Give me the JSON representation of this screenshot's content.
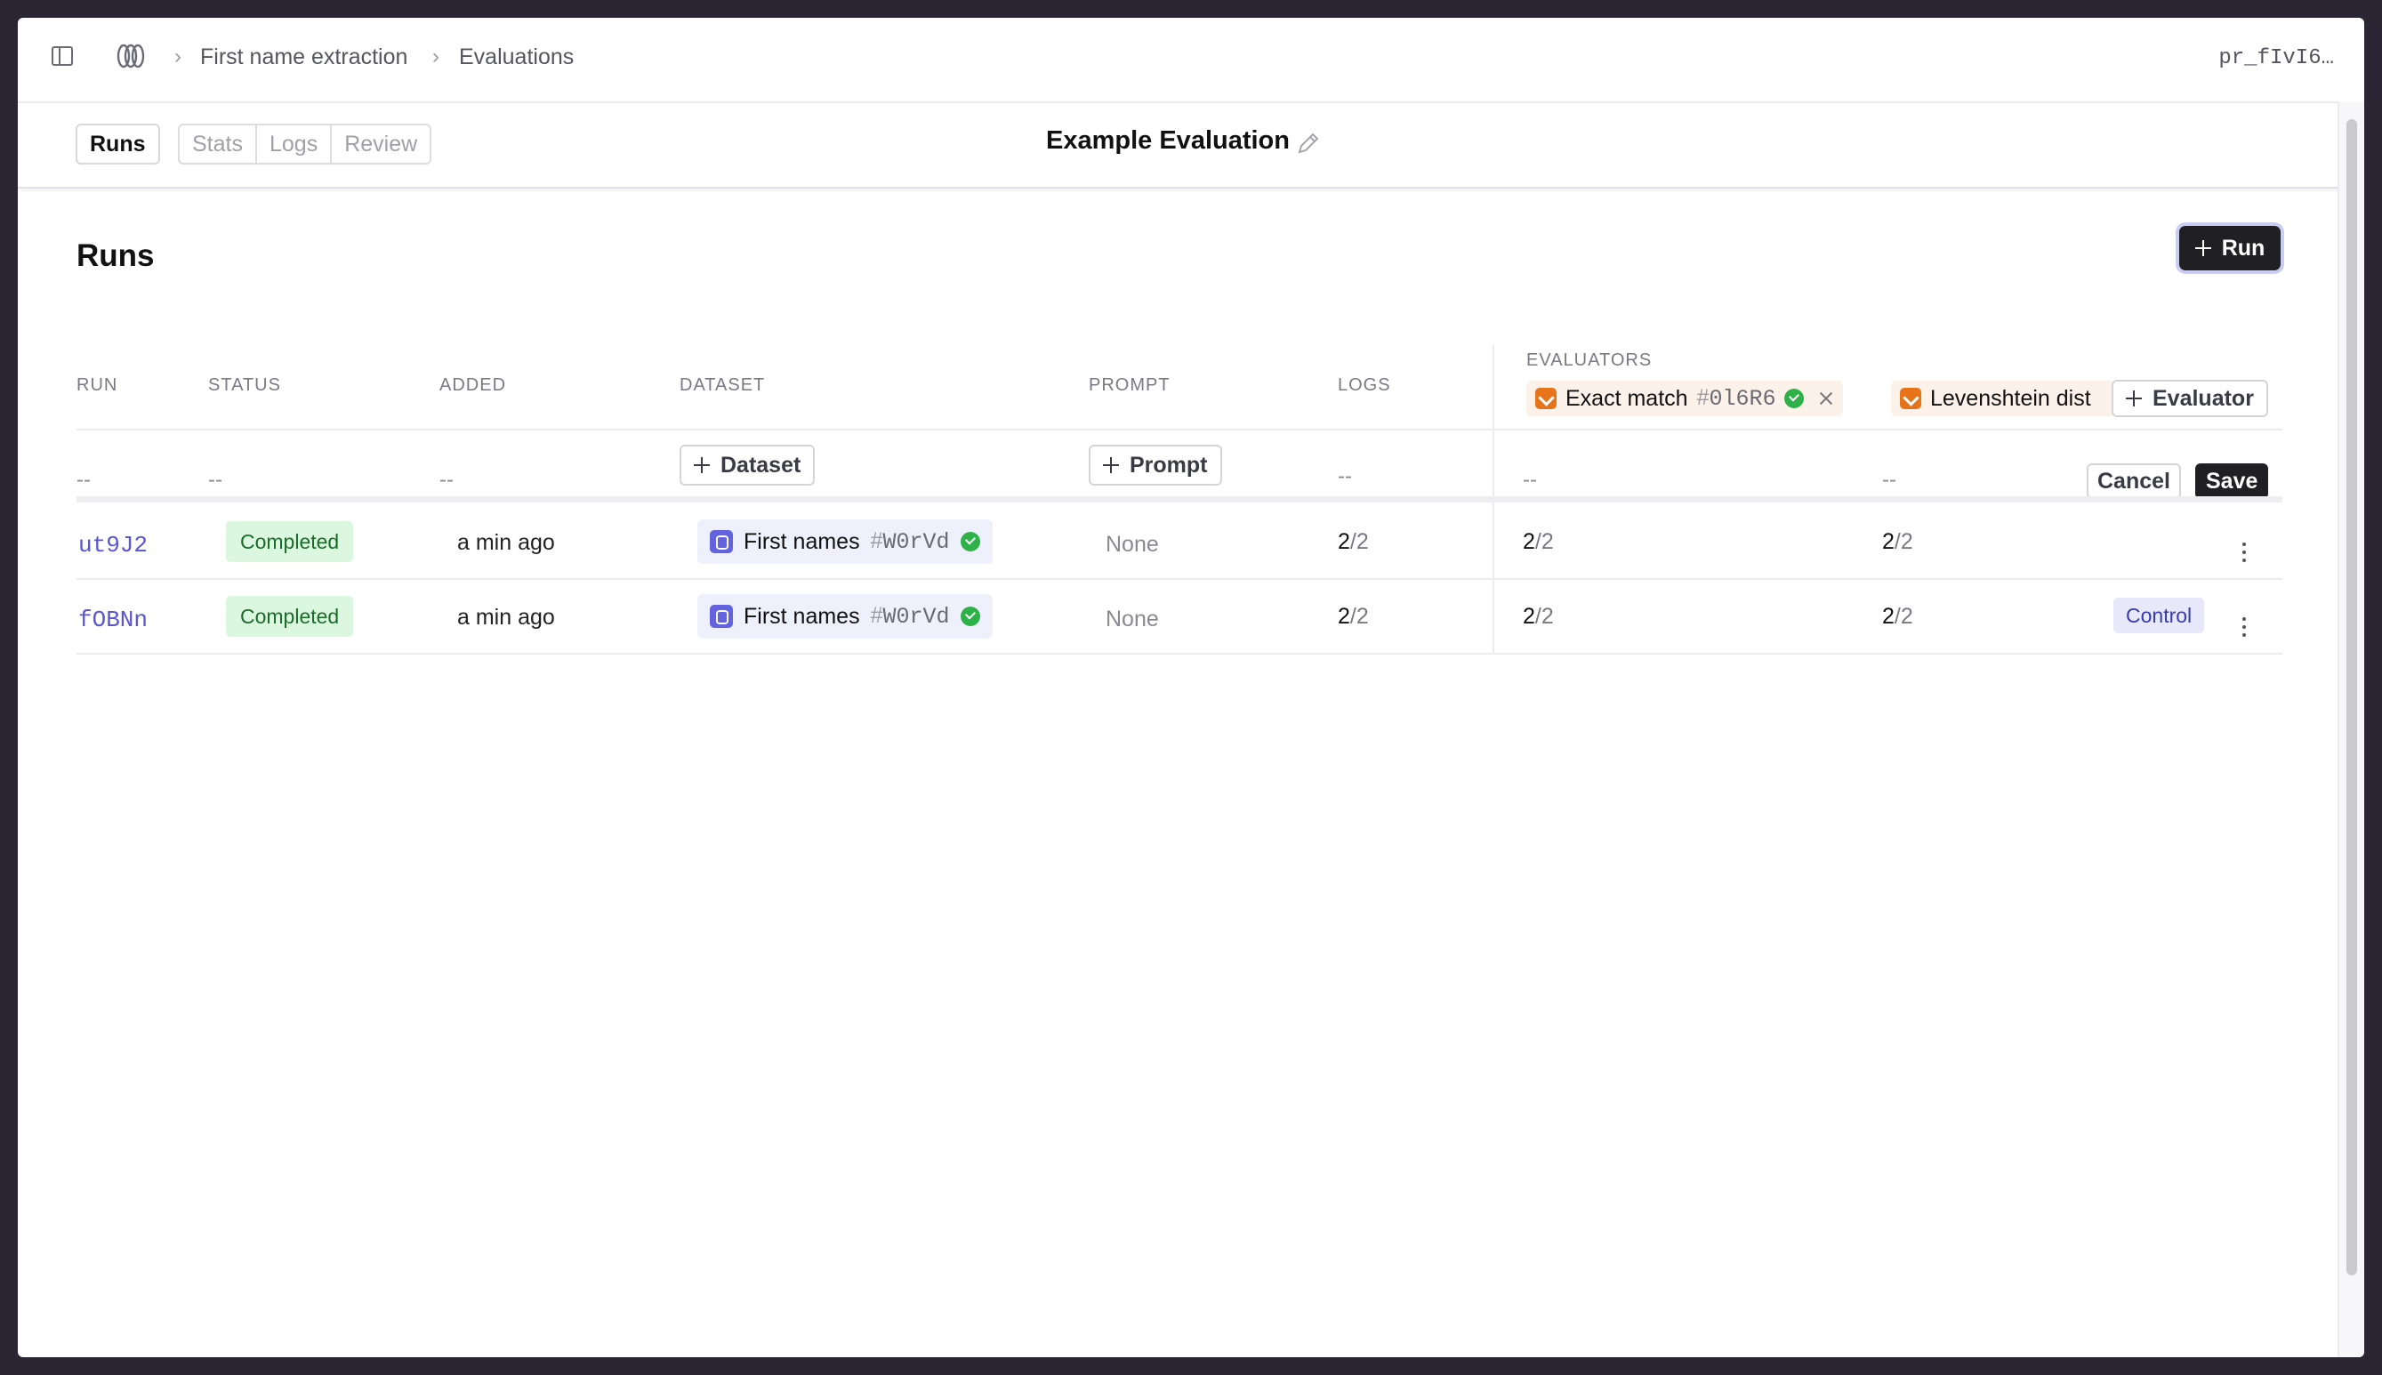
{
  "breadcrumb": {
    "items": [
      "First name extraction",
      "Evaluations"
    ]
  },
  "topbar": {
    "id_label": "pr_fIvI6…"
  },
  "tabs": {
    "active": "Runs",
    "others": [
      "Stats",
      "Logs",
      "Review"
    ]
  },
  "evaluation": {
    "title": "Example Evaluation"
  },
  "page": {
    "title": "Runs",
    "run_button": "Run"
  },
  "table": {
    "headers": {
      "run": "RUN",
      "status": "STATUS",
      "added": "ADDED",
      "dataset": "DATASET",
      "prompt": "PROMPT",
      "logs": "LOGS",
      "evaluators": "EVALUATORS"
    },
    "evaluators": [
      {
        "name": "Exact match",
        "hash": "#",
        "id": "0l6R6"
      },
      {
        "name": "Levenshtein dist"
      }
    ],
    "add_evaluator": "Evaluator",
    "new_row": {
      "placeholder": "--",
      "dataset_button": "Dataset",
      "prompt_button": "Prompt",
      "cancel": "Cancel",
      "save": "Save"
    },
    "rows": [
      {
        "run": "ut9J2",
        "status": "Completed",
        "added": "a min ago",
        "dataset": "First names",
        "hash": "#",
        "dataset_id": "W0rVd",
        "prompt": "None",
        "logs_num": "2",
        "logs_den": "/2",
        "e1_num": "2",
        "e1_den": "/2",
        "e2_num": "2",
        "e2_den": "/2"
      },
      {
        "run": "fOBNn",
        "status": "Completed",
        "added": "a min ago",
        "dataset": "First names",
        "hash": "#",
        "dataset_id": "W0rVd",
        "prompt": "None",
        "logs_num": "2",
        "logs_den": "/2",
        "e1_num": "2",
        "e1_den": "/2",
        "e2_num": "2",
        "e2_den": "/2",
        "badge": "Control"
      }
    ]
  },
  "colors": {
    "accent": "#5a55d6",
    "success": "#2fb14a",
    "evaluator": "#e8741a",
    "dataset": "#6363e0"
  }
}
